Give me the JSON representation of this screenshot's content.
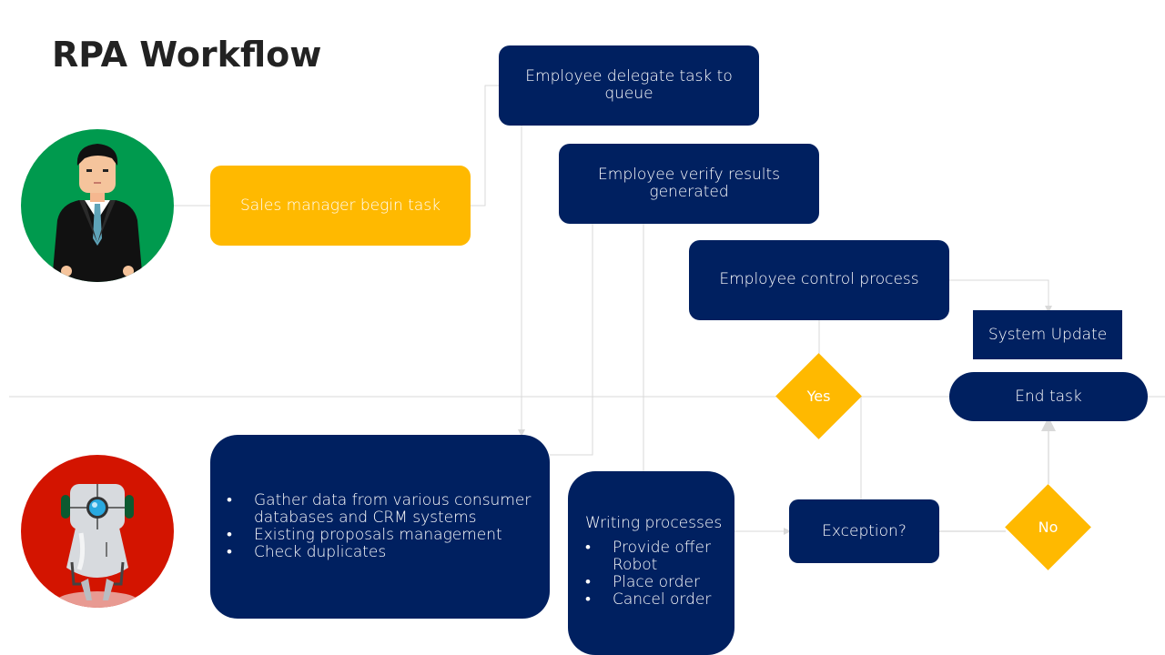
{
  "slide": {
    "title": "RPA Workflow"
  },
  "lanes": {
    "human": {
      "avatar": "businessman-illustration",
      "color": "#009A4E"
    },
    "robot": {
      "avatar": "robot-illustration",
      "color": "#D31400"
    }
  },
  "nodes": {
    "start": {
      "label": "Sales manager begin task",
      "color": "#FFB900"
    },
    "delegate": {
      "label": "Employee delegate task to queue",
      "line1": "Employee delegate task to",
      "line2": "queue"
    },
    "verify": {
      "label": "Employee verify results generated",
      "line1": "Employee verify results",
      "line2": "generated"
    },
    "control": {
      "label": "Employee control process"
    },
    "system_update": {
      "label": "System Update"
    },
    "end_task": {
      "label": "End task"
    },
    "gather": {
      "items": [
        "Gather data from various consumer databases and CRM systems",
        "Existing proposals management",
        "Check duplicates"
      ]
    },
    "writing": {
      "heading": "Writing processes",
      "items": [
        "Provide offer Robot",
        "Place order",
        "Cancel order"
      ]
    },
    "exception": {
      "label": "Exception?"
    },
    "yes": {
      "label": "Yes"
    },
    "no": {
      "label": "No"
    }
  },
  "colors": {
    "primary": "#002060",
    "accent": "#FFB900",
    "connector": "#D9D9D9",
    "title": "#222222"
  }
}
